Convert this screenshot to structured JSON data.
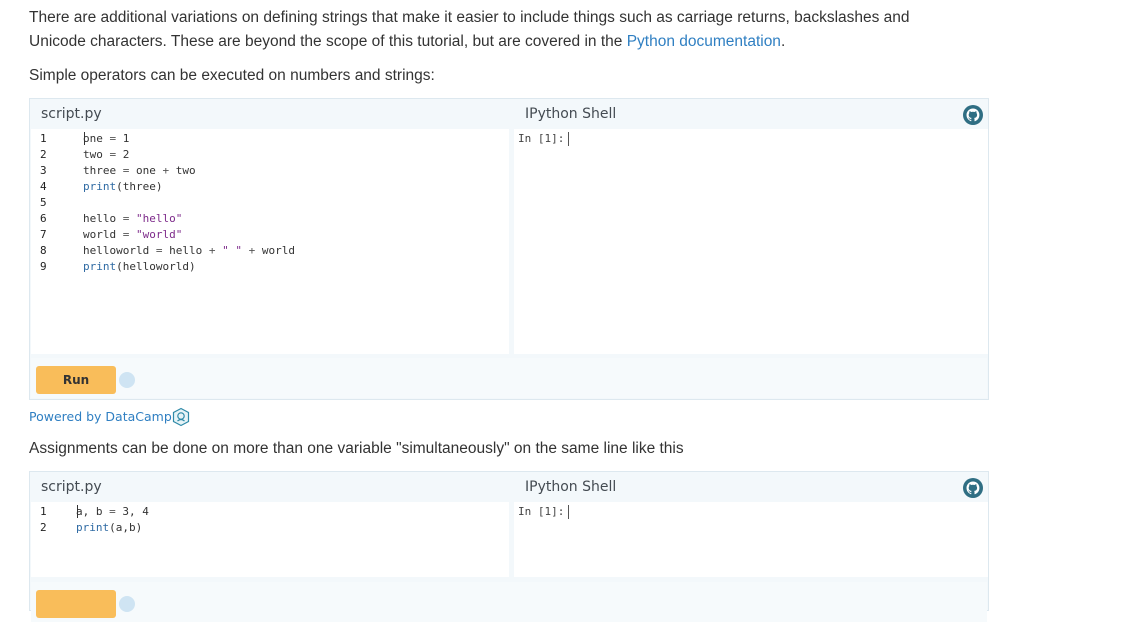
{
  "intro": {
    "line1": "There are additional variations on defining strings that make it easier to include things such as carriage returns, backslashes and",
    "line2_before": "Unicode characters. These are beyond the scope of this tutorial, but are covered in the ",
    "line2_link": "Python documentation",
    "line2_after": "."
  },
  "ops_text": "Simple operators can be executed on numbers and strings:",
  "widget1": {
    "editor_title": "script.py",
    "shell_title": "IPython Shell",
    "shell_prompt": "In [1]:",
    "run_label": "Run",
    "lines": [
      {
        "n": "1",
        "code": [
          {
            "t": "one ",
            "c": ""
          },
          {
            "t": "=",
            "c": "op"
          },
          {
            "t": " 1",
            "c": ""
          }
        ]
      },
      {
        "n": "2",
        "code": [
          {
            "t": "two ",
            "c": ""
          },
          {
            "t": "=",
            "c": "op"
          },
          {
            "t": " 2",
            "c": ""
          }
        ]
      },
      {
        "n": "3",
        "code": [
          {
            "t": "three ",
            "c": ""
          },
          {
            "t": "=",
            "c": "op"
          },
          {
            "t": " one ",
            "c": ""
          },
          {
            "t": "+",
            "c": "op"
          },
          {
            "t": " two",
            "c": ""
          }
        ]
      },
      {
        "n": "4",
        "code": [
          {
            "t": "print",
            "c": "kw"
          },
          {
            "t": "(three)",
            "c": ""
          }
        ]
      },
      {
        "n": "5",
        "code": []
      },
      {
        "n": "6",
        "code": [
          {
            "t": "hello ",
            "c": ""
          },
          {
            "t": "=",
            "c": "op"
          },
          {
            "t": " ",
            "c": ""
          },
          {
            "t": "\"hello\"",
            "c": "str"
          }
        ]
      },
      {
        "n": "7",
        "code": [
          {
            "t": "world ",
            "c": ""
          },
          {
            "t": "=",
            "c": "op"
          },
          {
            "t": " ",
            "c": ""
          },
          {
            "t": "\"world\"",
            "c": "str"
          }
        ]
      },
      {
        "n": "8",
        "code": [
          {
            "t": "helloworld ",
            "c": ""
          },
          {
            "t": "=",
            "c": "op"
          },
          {
            "t": " hello ",
            "c": ""
          },
          {
            "t": "+",
            "c": "op"
          },
          {
            "t": " ",
            "c": ""
          },
          {
            "t": "\" \"",
            "c": "str"
          },
          {
            "t": " ",
            "c": ""
          },
          {
            "t": "+",
            "c": "op"
          },
          {
            "t": " world",
            "c": ""
          }
        ]
      },
      {
        "n": "9",
        "code": [
          {
            "t": "print",
            "c": "kw"
          },
          {
            "t": "(helloworld)",
            "c": ""
          }
        ]
      }
    ]
  },
  "powered_by": "Powered by DataCamp",
  "assign_text": "Assignments can be done on more than one variable \"simultaneously\" on the same line like this",
  "widget2": {
    "editor_title": "script.py",
    "shell_title": "IPython Shell",
    "shell_prompt": "In [1]:",
    "lines": [
      {
        "n": "1",
        "code": [
          {
            "t": "a, b ",
            "c": ""
          },
          {
            "t": "=",
            "c": "op"
          },
          {
            "t": " 3, 4",
            "c": ""
          }
        ]
      },
      {
        "n": "2",
        "code": [
          {
            "t": "print",
            "c": "kw"
          },
          {
            "t": "(a,b)",
            "c": ""
          }
        ]
      }
    ]
  },
  "icons": {
    "github": "github-icon",
    "datacamp": "datacamp-logo-icon"
  },
  "colors": {
    "link": "#2f7fc2",
    "run_button": "#f9bd5a",
    "widget_bg": "#f3f8fb"
  }
}
